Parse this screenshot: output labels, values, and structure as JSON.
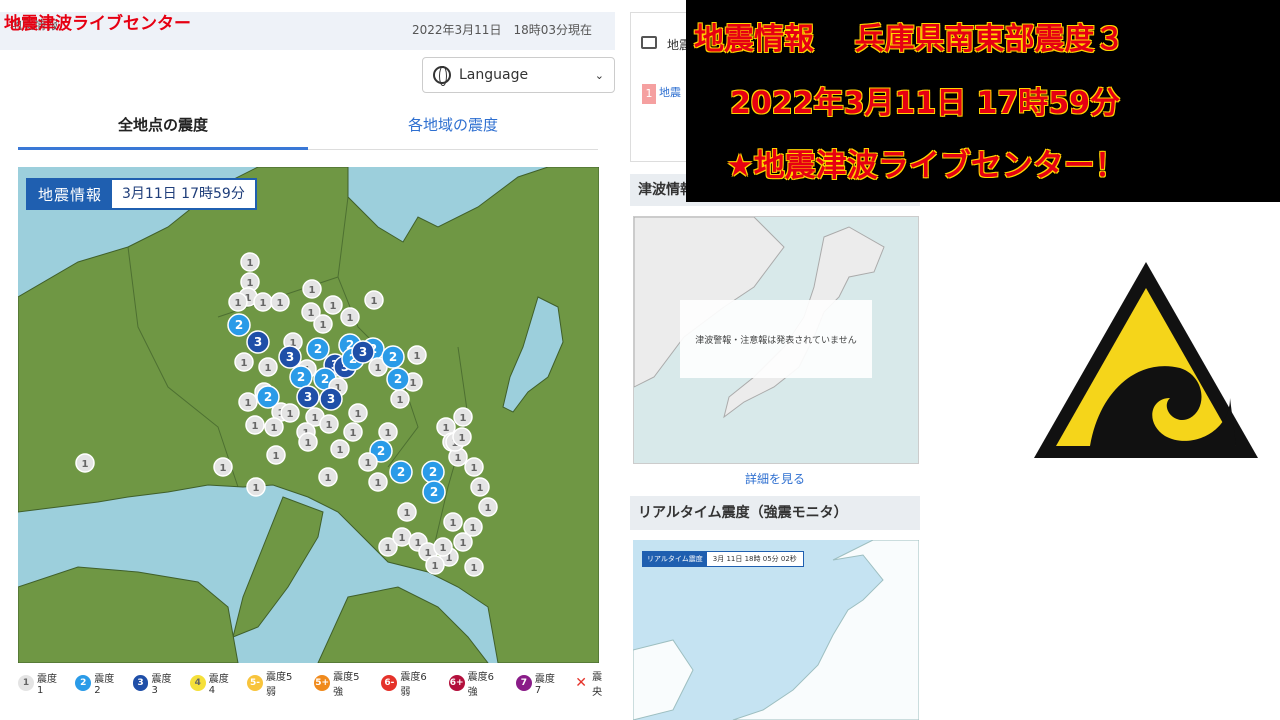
{
  "header": {
    "title": "地震情報",
    "overlay_title": "地震津波ライブセンター",
    "datetime": "2022年3月11日　18時03分現在"
  },
  "language": {
    "label": "Language"
  },
  "tabs": [
    {
      "label": "全地点の震度",
      "active": true
    },
    {
      "label": "各地域の震度",
      "active": false
    }
  ],
  "map": {
    "badge_label": "地震情報",
    "badge_value": "3月11日 17時59分",
    "colors": {
      "sea": "#9ccfdc",
      "land": "#6f9744"
    }
  },
  "markers": [
    {
      "v": "1"
    },
    {
      "v": "1"
    },
    {
      "v": "1"
    },
    {
      "v": "1"
    },
    {
      "v": "1"
    },
    {
      "v": "1"
    },
    {
      "v": "1"
    },
    {
      "v": "1"
    },
    {
      "v": "1"
    },
    {
      "v": "1"
    },
    {
      "v": "1"
    },
    {
      "v": "1"
    },
    {
      "v": "2"
    },
    {
      "v": "3"
    },
    {
      "v": "1"
    },
    {
      "v": "1"
    },
    {
      "v": "3"
    },
    {
      "v": "2"
    },
    {
      "v": "3"
    },
    {
      "v": "2"
    },
    {
      "v": "3"
    },
    {
      "v": "2"
    },
    {
      "v": "2"
    },
    {
      "v": "1"
    },
    {
      "v": "1"
    },
    {
      "v": "3"
    },
    {
      "v": "1"
    },
    {
      "v": "1"
    },
    {
      "v": "2"
    },
    {
      "v": "2"
    },
    {
      "v": "1"
    },
    {
      "v": "1"
    },
    {
      "v": "2"
    },
    {
      "v": "3"
    },
    {
      "v": "1"
    },
    {
      "v": "1"
    },
    {
      "v": "1"
    },
    {
      "v": "1"
    },
    {
      "v": "1"
    },
    {
      "v": "2"
    },
    {
      "v": "1"
    },
    {
      "v": "1"
    },
    {
      "v": "1"
    },
    {
      "v": "3"
    },
    {
      "v": "1"
    },
    {
      "v": "2"
    },
    {
      "v": "1"
    },
    {
      "v": "1"
    },
    {
      "v": "1"
    },
    {
      "v": "1"
    },
    {
      "v": "1"
    },
    {
      "v": "1"
    },
    {
      "v": "2"
    },
    {
      "v": "1"
    },
    {
      "v": "1"
    },
    {
      "v": "1"
    },
    {
      "v": "1"
    },
    {
      "v": "1"
    },
    {
      "v": "1"
    },
    {
      "v": "1"
    },
    {
      "v": "2"
    },
    {
      "v": "1"
    },
    {
      "v": "2"
    },
    {
      "v": "1"
    },
    {
      "v": "1"
    },
    {
      "v": "1"
    },
    {
      "v": "2"
    },
    {
      "v": "1"
    },
    {
      "v": "1"
    },
    {
      "v": "1"
    },
    {
      "v": "1"
    },
    {
      "v": "1"
    },
    {
      "v": "1"
    },
    {
      "v": "1"
    },
    {
      "v": "1"
    },
    {
      "v": "1"
    },
    {
      "v": "1"
    },
    {
      "v": "1"
    },
    {
      "v": "1"
    },
    {
      "v": "1"
    },
    {
      "v": "1"
    },
    {
      "v": "1"
    },
    {
      "v": "1"
    },
    {
      "v": "1"
    },
    {
      "v": "1"
    }
  ],
  "legend": [
    {
      "n": "1",
      "label": "震度1",
      "color": "#e4e4e4",
      "text": "#666"
    },
    {
      "n": "2",
      "label": "震度2",
      "color": "#2a9be8",
      "text": "#fff"
    },
    {
      "n": "3",
      "label": "震度3",
      "color": "#1f4fa8",
      "text": "#fff"
    },
    {
      "n": "4",
      "label": "震度4",
      "color": "#f5e03a",
      "text": "#666"
    },
    {
      "n": "5-",
      "label": "震度5弱",
      "color": "#f8c43c",
      "text": "#fff"
    },
    {
      "n": "5+",
      "label": "震度5強",
      "color": "#f08a1c",
      "text": "#fff"
    },
    {
      "n": "6-",
      "label": "震度6弱",
      "color": "#e5322a",
      "text": "#fff"
    },
    {
      "n": "6+",
      "label": "震度6強",
      "color": "#b3103c",
      "text": "#fff"
    },
    {
      "n": "7",
      "label": "震度7",
      "color": "#8a1c88",
      "text": "#fff"
    },
    {
      "n": "✕",
      "label": "震央",
      "color": "transparent",
      "text": "#e5322a"
    }
  ],
  "sidebar": {
    "label": "地震",
    "num": "1",
    "link": "地震"
  },
  "tsunami": {
    "heading": "津波情報",
    "message": "津波警報・注意報は発表されていません",
    "more": "詳細を見る"
  },
  "realtime": {
    "heading": "リアルタイム震度（強震モニタ）",
    "badge_label": "リアルタイム震度",
    "badge_value": "3月 11日 18時 05分 02秒"
  },
  "overlay": {
    "line1": "地震情報　 兵庫県南東部震度３",
    "line2": "2022年3月11日 17時59分",
    "line3": "★地震津波ライブセンター！"
  }
}
